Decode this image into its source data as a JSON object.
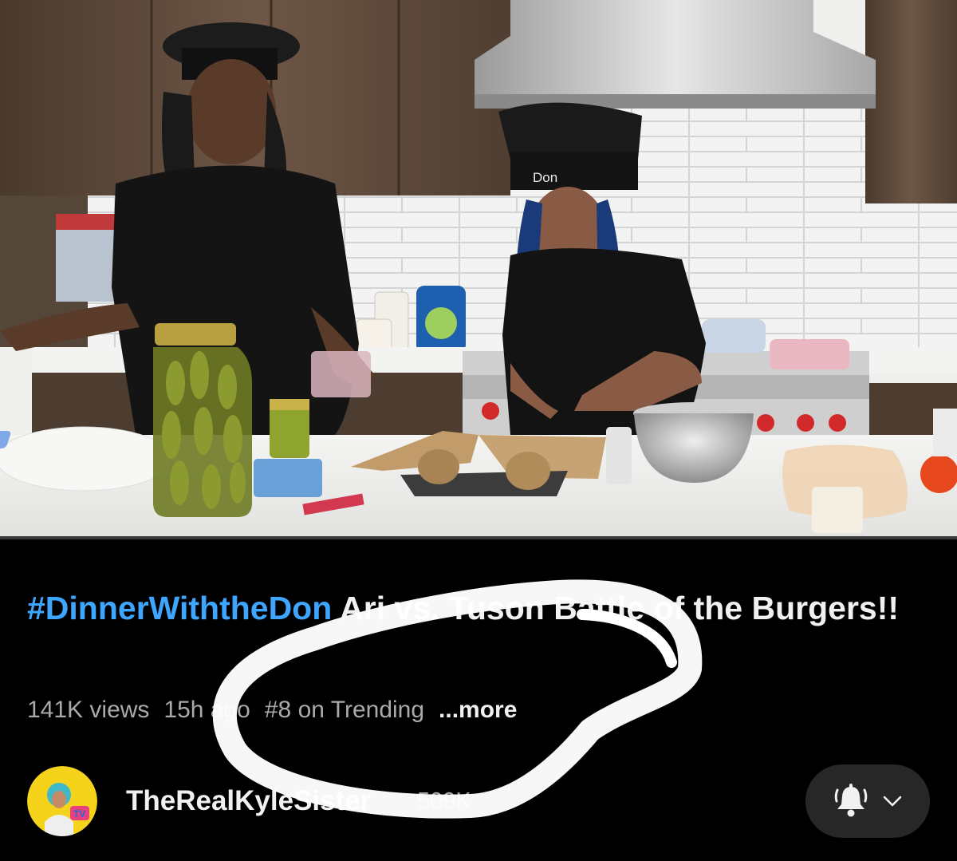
{
  "video": {
    "hat_text": "Don",
    "progress_fraction": 0.0
  },
  "title": {
    "hashtag": "#DinnerWiththeDon",
    "text": " Ari vs. Tuson Battle of the Burgers!!"
  },
  "meta": {
    "views": "141K views",
    "age": "15h ago",
    "trending": "#8 on Trending",
    "more": "...more"
  },
  "channel": {
    "name": "TheRealKyleSister",
    "subscribers": "509K",
    "avatar_label": "TV"
  },
  "subscribe_button": {
    "icon": "bell-icon",
    "dropdown_icon": "chevron-down-icon"
  },
  "colors": {
    "hashtag": "#3ea6ff",
    "background": "#000000",
    "button_bg": "#272727",
    "avatar_bg": "#f4d31a"
  }
}
